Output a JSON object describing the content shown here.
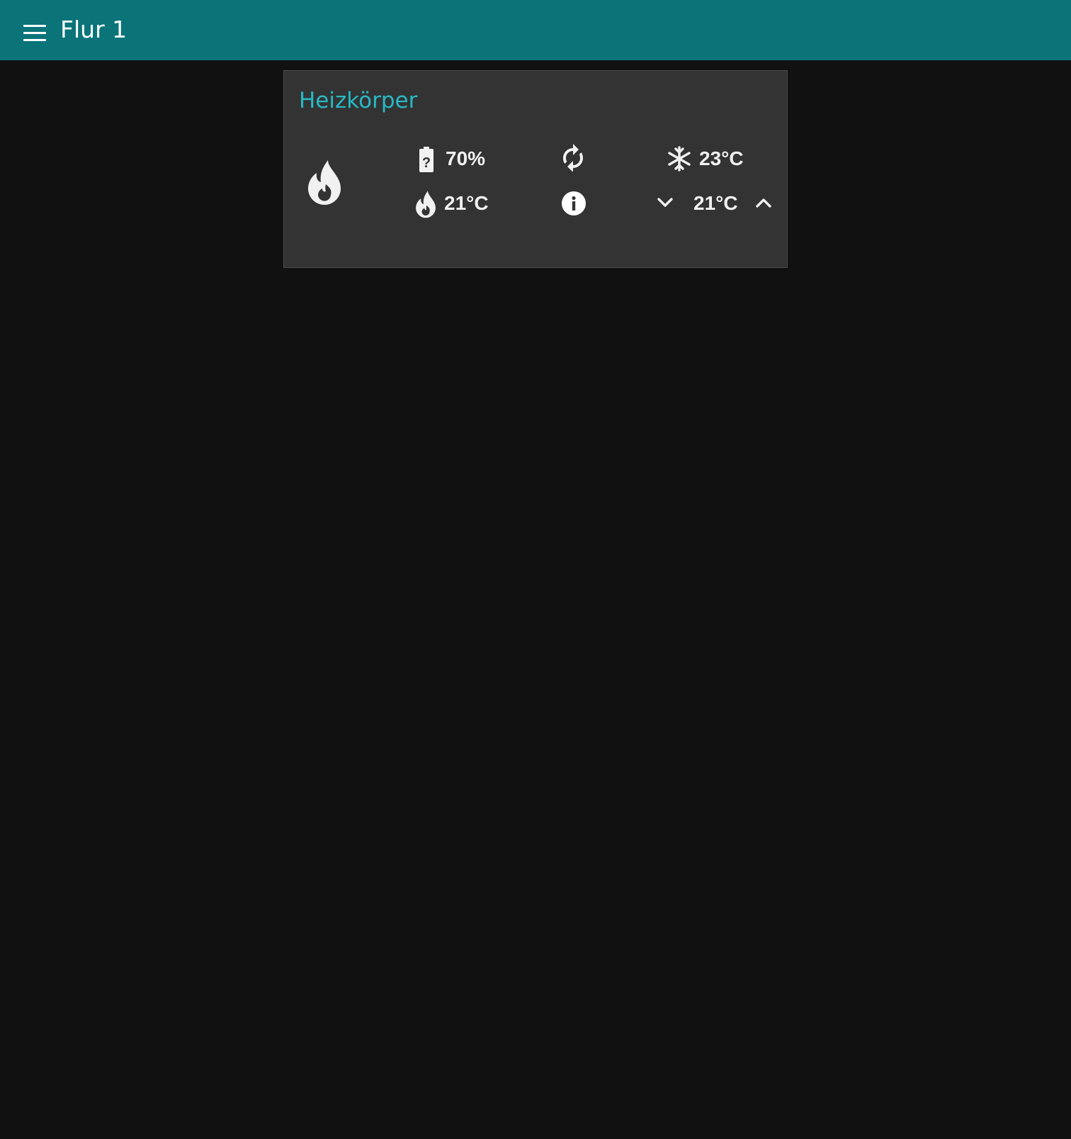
{
  "header": {
    "title": "Flur 1",
    "menu_icon": "hamburger-menu-icon",
    "background_color": "#0a7479"
  },
  "card": {
    "title": "Heizkörper",
    "title_color": "#27b9c4",
    "mode_icon": "flame-icon",
    "battery": {
      "icon": "battery-unknown-icon",
      "value": "70%"
    },
    "current_temperature": {
      "icon": "flame-icon",
      "value": "21°C"
    },
    "sync_icon": "sync-icon",
    "info_icon": "info-icon",
    "cooling_temperature": {
      "icon": "snowflake-icon",
      "value": "23°C"
    },
    "setpoint": {
      "decrease_icon": "chevron-down-icon",
      "value": "21°C",
      "increase_icon": "chevron-up-icon"
    }
  }
}
